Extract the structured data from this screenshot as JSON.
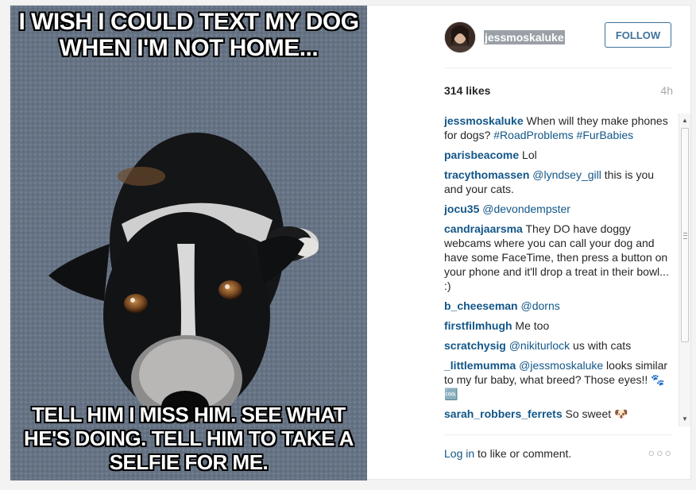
{
  "photo": {
    "caption_top": "I WISH I COULD TEXT MY DOG WHEN I'M NOT HOME...",
    "caption_bottom": "TELL HIM I MISS HIM. SEE WHAT HE'S DOING. TELL HIM TO TAKE A SELFIE FOR ME."
  },
  "header": {
    "username": "jessmoskaluke",
    "follow_label": "FOLLOW"
  },
  "stats": {
    "likes": "314 likes",
    "time": "4h"
  },
  "comments": [
    {
      "user": "jessmoskaluke",
      "text": " When will they make phones for dogs? ",
      "tags": "#RoadProblems #FurBabies"
    },
    {
      "user": "parisbeacome",
      "text": " Lol",
      "tags": ""
    },
    {
      "user": "tracythomassen",
      "mention": " @lyndsey_gill",
      "text": " this is you and your cats."
    },
    {
      "user": "jocu35",
      "mention": " @devondempster",
      "text": ""
    },
    {
      "user": "candrajaarsma",
      "text": " They DO have doggy webcams where you can call your dog and have some FaceTime, then press a button on your phone and it'll drop a treat in their bowl... :)"
    },
    {
      "user": "b_cheeseman",
      "mention": " @dorns",
      "text": ""
    },
    {
      "user": "firstfilmhugh",
      "text": " Me too"
    },
    {
      "user": "scratchysig",
      "mention": " @nikiturlock",
      "text": " us with cats"
    },
    {
      "user": "_littlemumma",
      "mention": " @jessmoskaluke",
      "text": " looks similar to my fur baby, what breed? Those eyes!! 🐾 🆒"
    },
    {
      "user": "sarah_robbers_ferrets",
      "text": " So sweet 🐶"
    }
  ],
  "footer": {
    "login_label": "Log in",
    "rest": " to like or comment.",
    "more": "○○○"
  },
  "colors": {
    "link": "#125688",
    "follow": "#3f729b"
  }
}
